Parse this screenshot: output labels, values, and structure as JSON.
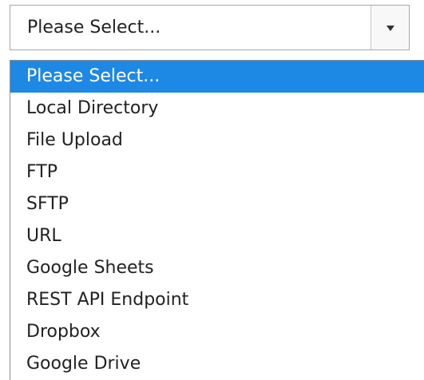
{
  "select": {
    "value": "Please Select...",
    "options": [
      "Please Select...",
      "Local Directory",
      "File Upload",
      "FTP",
      "SFTP",
      "URL",
      "Google Sheets",
      "REST API Endpoint",
      "Dropbox",
      "Google Drive"
    ],
    "selected_index": 0,
    "icon": "chevron-down-icon"
  },
  "colors": {
    "highlight": "#1e88e5",
    "text": "#222222",
    "border": "#a9a9a9"
  }
}
